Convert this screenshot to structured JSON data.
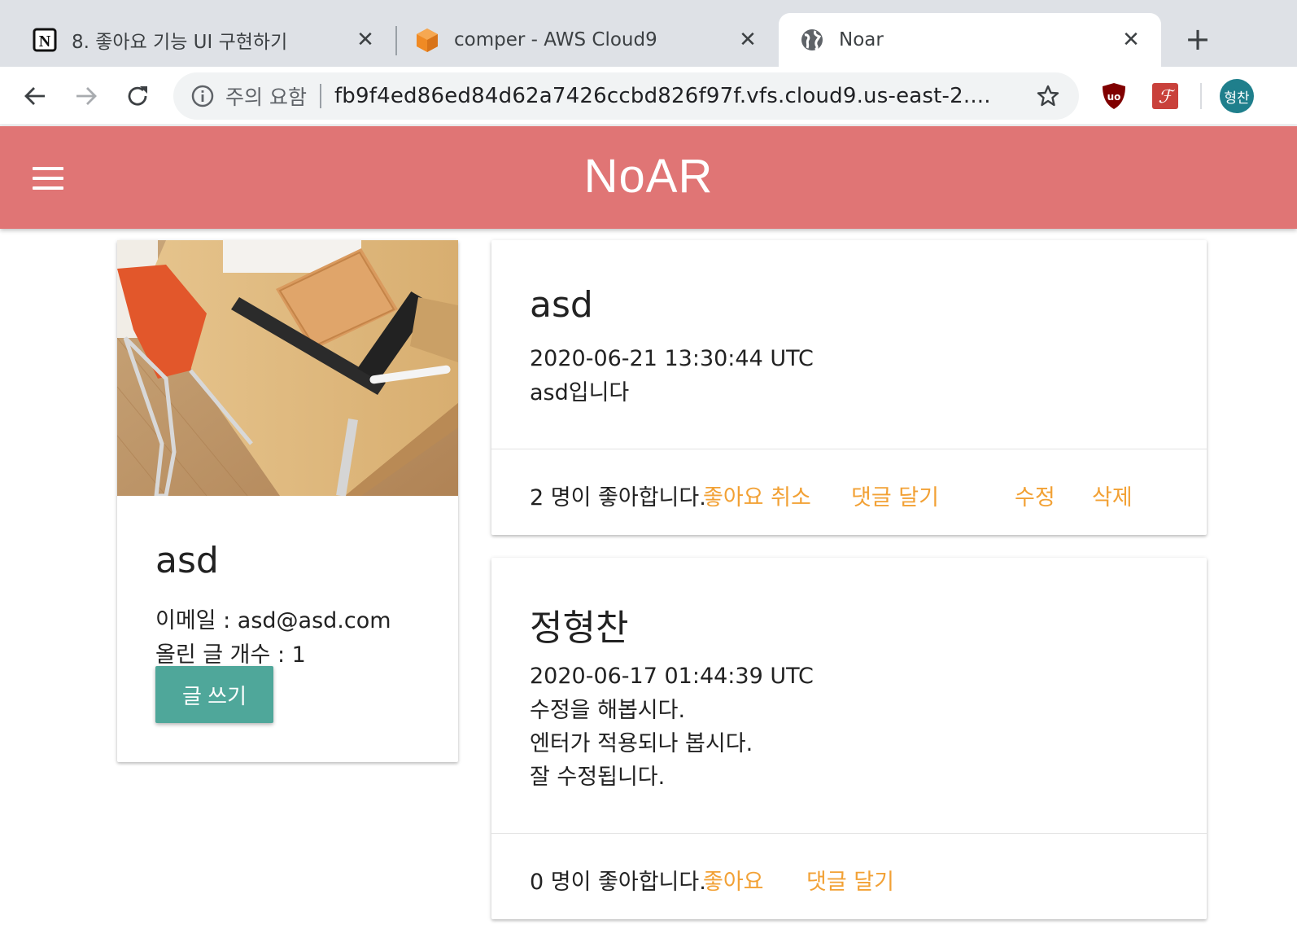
{
  "browser": {
    "tabs": [
      {
        "title": "8. 좋아요 기능 UI 구현하기",
        "icon": "notion-icon",
        "active": false
      },
      {
        "title": "comper - AWS Cloud9",
        "icon": "aws-cloud9-icon",
        "active": false
      },
      {
        "title": "Noar",
        "icon": "globe-icon",
        "active": true
      }
    ],
    "close_glyph": "✕",
    "new_tab_glyph": "+",
    "address": {
      "security_label": "주의 요함",
      "url": "fb9f4ed86ed84d62a7426ccbd826f97f.vfs.cloud9.us-east-2...."
    },
    "extensions": [
      "ublock-origin-icon",
      "font-extension-icon"
    ],
    "extension_labels": [
      "uo",
      "ℱ"
    ],
    "profile_initials": "형찬"
  },
  "appbar": {
    "title": "NoAR",
    "menu_icon": "hamburger-menu-icon",
    "color": "#e07575"
  },
  "profile": {
    "name": "asd",
    "email_line": "이메일 : asd@asd.com",
    "post_count_line": "올린 글 개수 : 1",
    "write_button": "글 쓰기",
    "button_color": "#4fa79a"
  },
  "posts": [
    {
      "title": "asd",
      "date": "2020-06-21 13:30:44 UTC",
      "body": "asd입니다",
      "likes_text": "2 명이 좋아합니다.",
      "like_action": "좋아요 취소",
      "comment_action": "댓글 달기",
      "edit_action": "수정",
      "delete_action": "삭제"
    },
    {
      "title": "정형찬",
      "date": "2020-06-17 01:44:39 UTC",
      "body": "수정을 해봅시다.\n엔터가 적용되나 봅시다.\n잘 수정됩니다.",
      "likes_text": "0 명이 좋아합니다.",
      "like_action": "좋아요",
      "comment_action": "댓글 달기"
    }
  ],
  "colors": {
    "link": "#f2a135",
    "tabstrip": "#dee1e6"
  }
}
